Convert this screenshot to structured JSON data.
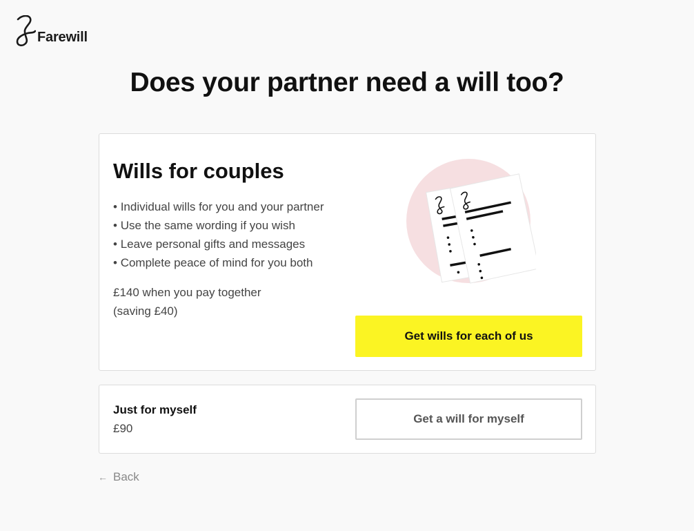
{
  "brand": {
    "name": "Farewill"
  },
  "page": {
    "title": "Does your partner need a will too?"
  },
  "couples": {
    "title": "Wills for couples",
    "benefits": [
      "Individual wills for you and your partner",
      "Use the same wording if you wish",
      "Leave personal gifts and messages",
      "Complete peace of mind for you both"
    ],
    "price_line": "£140 when you pay together",
    "saving_line": "(saving £40)",
    "button_label": "Get wills for each of us"
  },
  "single": {
    "title": "Just for myself",
    "price": "£90",
    "button_label": "Get a will for myself"
  },
  "nav": {
    "back_label": "Back",
    "back_icon": "arrow-left-icon"
  },
  "colors": {
    "accent_yellow": "#fbf423",
    "illustration_circle": "#f6dfe1",
    "background": "#f9f9f9"
  }
}
